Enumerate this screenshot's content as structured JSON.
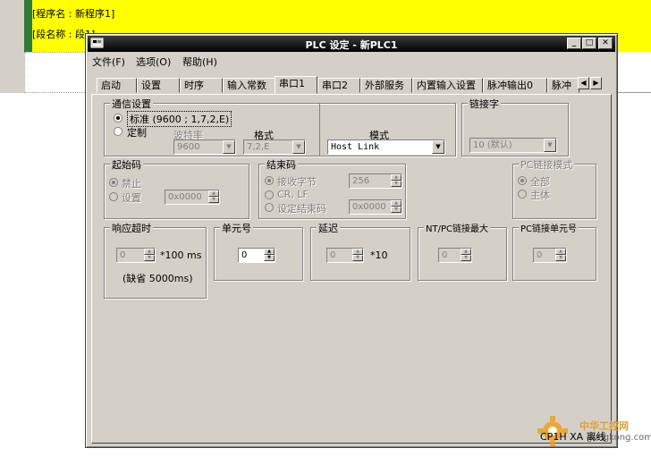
{
  "background": {
    "program_name_line": "[程序名 : 新程序1]",
    "section_name_line": "[段名称 : 段1]"
  },
  "window": {
    "title": "PLC 设定 - 新PLC1",
    "minimize_glyph": "_",
    "maximize_glyph": "□",
    "close_glyph": "✕"
  },
  "menu": [
    "文件(F)",
    "选项(O)",
    "帮助(H)"
  ],
  "tabs": [
    "启动",
    "设置",
    "时序",
    "输入常数",
    "串口1",
    "串口2",
    "外部服务",
    "内置输入设置",
    "脉冲输出0",
    "脉冲"
  ],
  "active_tab": "串口1",
  "comm_settings": {
    "label": "通信设置",
    "standard_option": "标准 (9600 ; 1,7,2,E)",
    "custom_option": "定制",
    "baud_label": "波特率",
    "baud_value": "9600",
    "format_label": "格式",
    "format_value": "7,2,E",
    "mode_label": "模式",
    "mode_value": "Host Link"
  },
  "link_word": {
    "label": "链接字",
    "value": "10 (默认)"
  },
  "start_code": {
    "label": "起始码",
    "disable": "禁止",
    "set": "设置",
    "value": "0x0000"
  },
  "end_code": {
    "label": "结束码",
    "receive_bytes": "接收字节",
    "receive_value": "256",
    "crlf": "CR, LF",
    "set_end_code": "设定结束码",
    "end_value": "0x0000"
  },
  "pc_link_mode": {
    "label": "PC链接模式",
    "all": "全部",
    "master": "主体"
  },
  "response_timeout": {
    "label": "响应超时",
    "value": "0",
    "unit": "*100 ms",
    "default_note": "(缺省 5000ms)"
  },
  "unit_number": {
    "label": "单元号",
    "value": "0"
  },
  "delay": {
    "label": "延迟",
    "value": "0",
    "unit": "*10"
  },
  "nt_pc_link_max": {
    "label": "NT/PC链接最大",
    "value": "0"
  },
  "pc_link_unit_no": {
    "label": "PC链接单元号",
    "value": "0"
  },
  "status": {
    "right_text": "CP1H XA 离线"
  },
  "watermark": {
    "text": "中华工控网",
    "sub": "gongkong.com"
  }
}
